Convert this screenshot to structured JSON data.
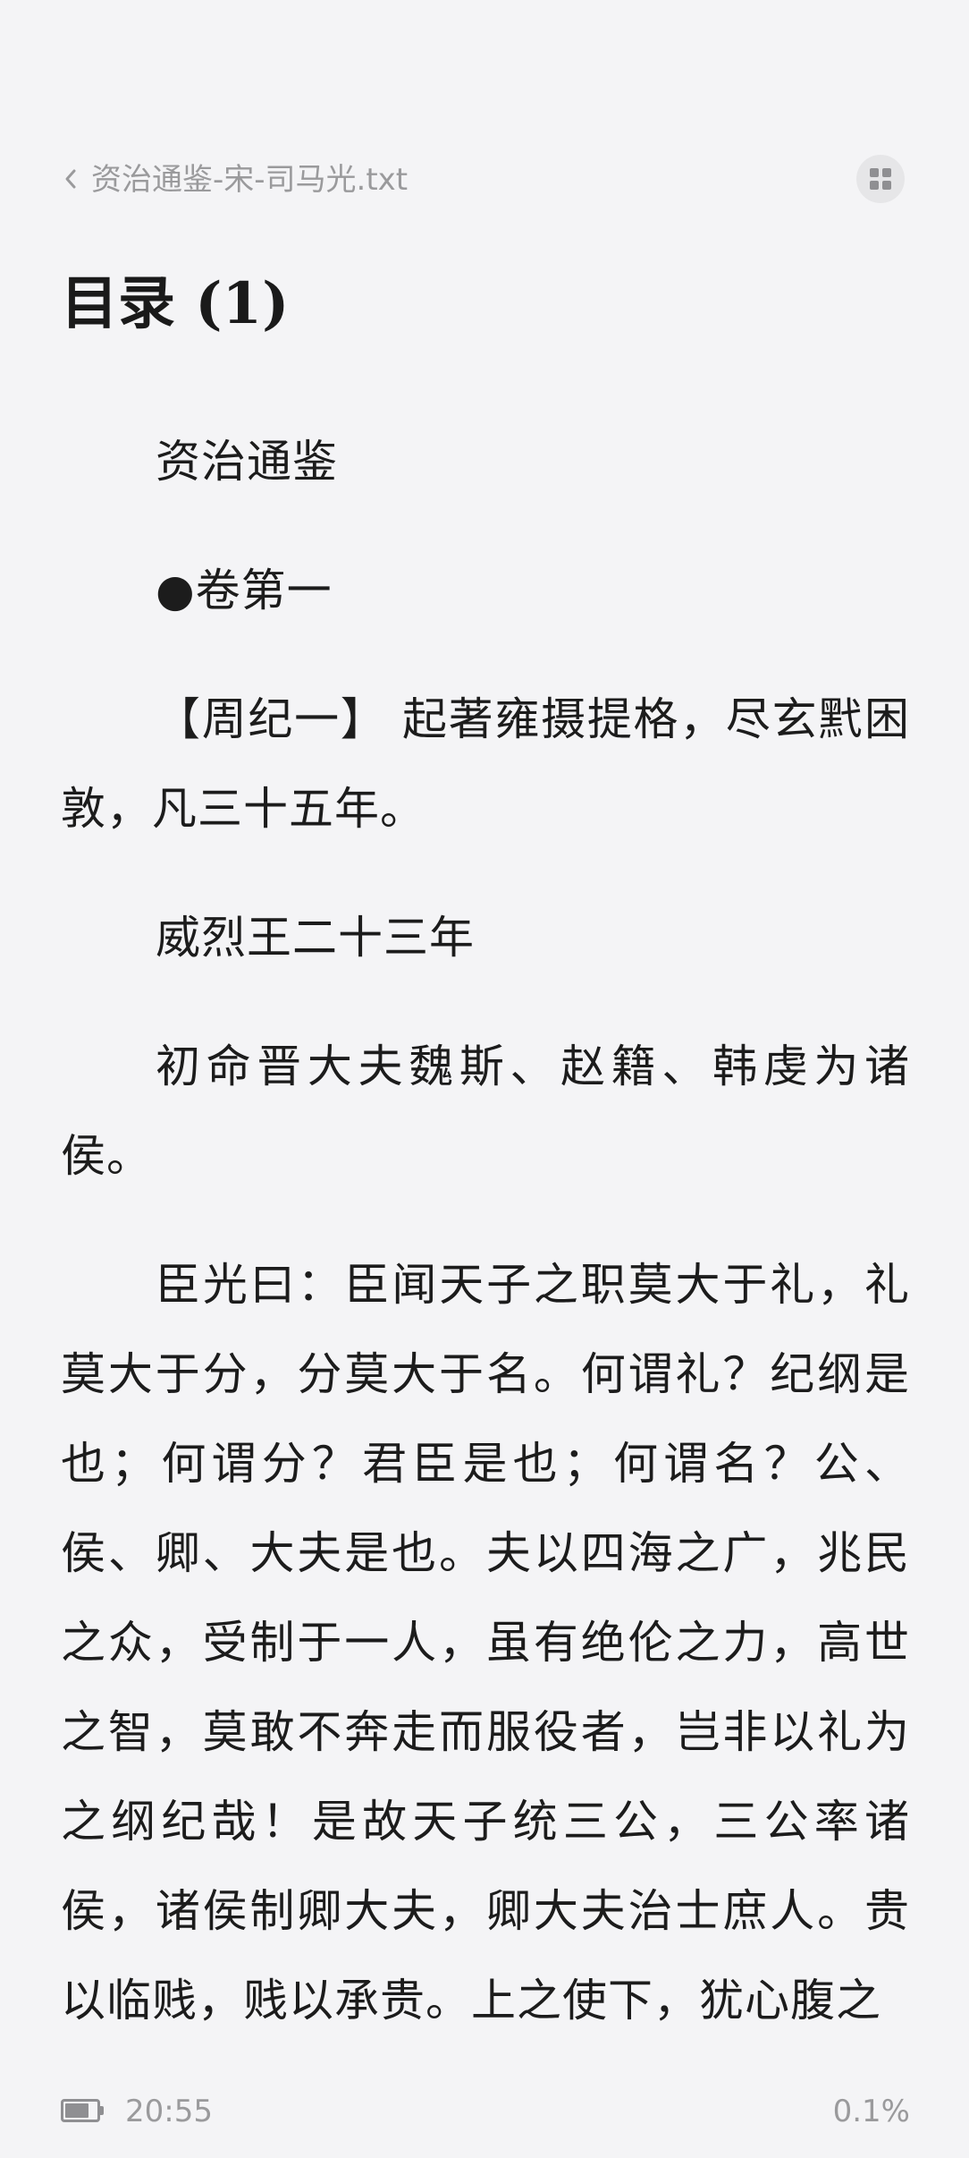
{
  "header": {
    "back_icon": "chevron-left-icon",
    "book_title": "资治通鉴-宋-司马光.txt",
    "menu_icon": "grid-icon"
  },
  "reader": {
    "chapter_title": "目录 (1)",
    "paragraphs": [
      "资治通鉴",
      "●卷第一",
      "【周纪一】 起著雍摄提格，尽玄黓困敦，凡三十五年。",
      "威烈王二十三年",
      "初命晋大夫魏斯、赵籍、韩虔为诸侯。",
      "臣光曰：臣闻天子之职莫大于礼，礼莫大于分，分莫大于名。何谓礼？纪纲是也；何谓分？君臣是也；何谓名？公、侯、卿、大夫是也。夫以四海之广，兆民之众，受制于一人，虽有绝伦之力，高世之智，莫敢不奔走而服役者，岂非以礼为之纲纪哉！是故天子统三公，三公率诸侯，诸侯制卿大夫，卿大夫治士庶人。贵以临贱，贱以承贵。上之使下，犹心腹之"
    ]
  },
  "status": {
    "battery_icon": "battery-icon",
    "battery_level": 0.75,
    "time": "20:55",
    "progress": "0.1%"
  }
}
